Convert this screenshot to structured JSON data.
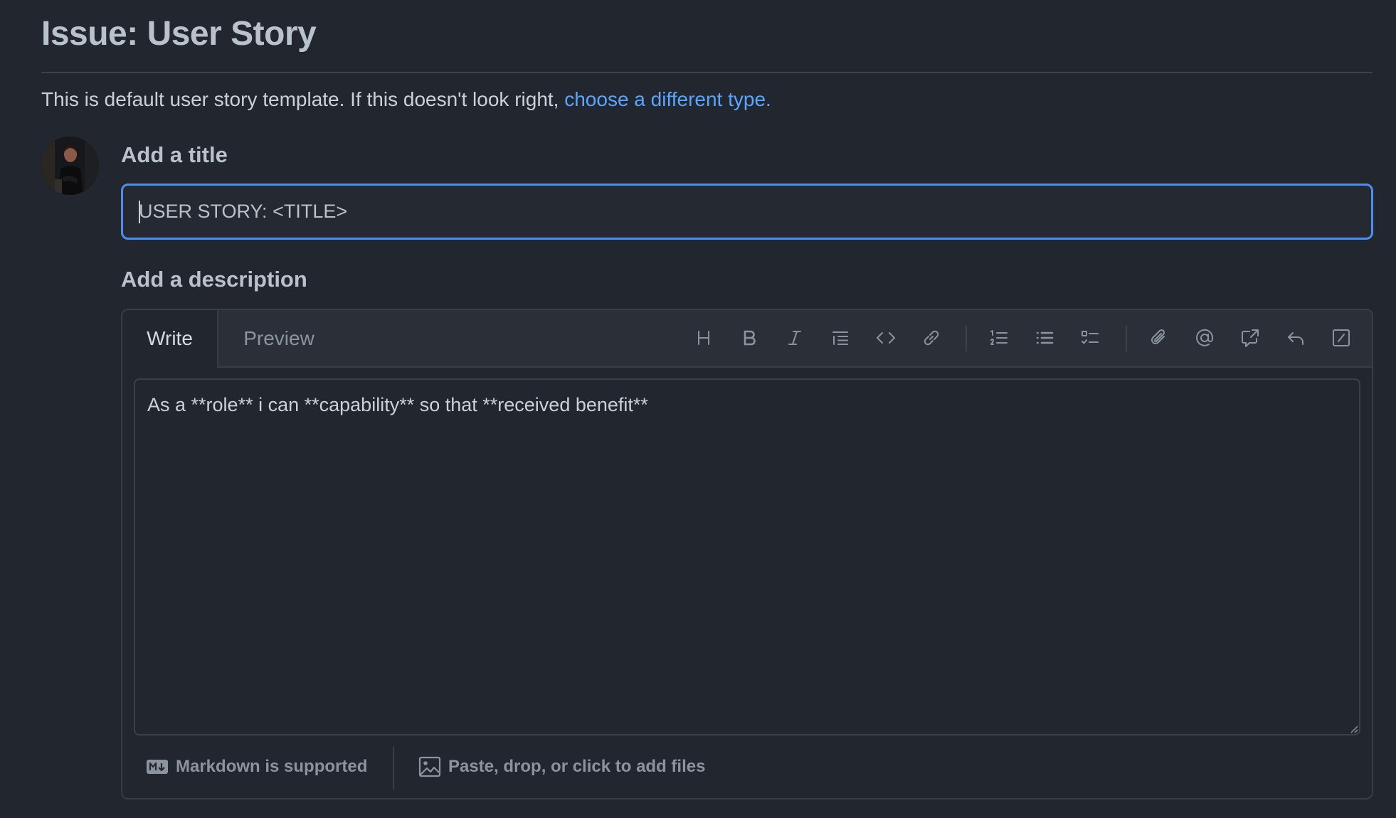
{
  "header": {
    "title": "Issue: User Story"
  },
  "template_note": {
    "text": "This is default user story template. If this doesn't look right, ",
    "link": "choose a different type."
  },
  "title_section": {
    "label": "Add a title",
    "value": "USER STORY: <TITLE>"
  },
  "description_section": {
    "label": "Add a description",
    "value": "As a **role** i can **capability** so that **received benefit**"
  },
  "editor": {
    "tabs": [
      {
        "label": "Write",
        "active": true
      },
      {
        "label": "Preview",
        "active": false
      }
    ],
    "toolbar": [
      {
        "icon": "heading-icon"
      },
      {
        "icon": "bold-icon"
      },
      {
        "icon": "italic-icon"
      },
      {
        "icon": "quote-icon"
      },
      {
        "icon": "code-icon"
      },
      {
        "icon": "link-icon"
      },
      {
        "icon": "numbered-list-icon"
      },
      {
        "icon": "bullet-list-icon"
      },
      {
        "icon": "task-list-icon"
      },
      {
        "icon": "attach-icon"
      },
      {
        "icon": "mention-icon"
      },
      {
        "icon": "cross-reference-icon"
      },
      {
        "icon": "saved-reply-icon"
      },
      {
        "icon": "slash-command-icon"
      }
    ],
    "footer": {
      "markdown_label": "Markdown is supported",
      "files_label": "Paste, drop, or click to add files"
    }
  },
  "colors": {
    "background": "#22262e",
    "accent": "#58a6ff",
    "focus_border": "#4c8fef"
  }
}
